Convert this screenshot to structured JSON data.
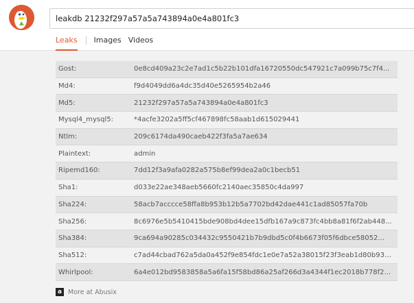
{
  "search": {
    "query": "leakdb 21232f297a57a5a743894a0e4a801fc3"
  },
  "tabs": [
    {
      "label": "Leaks"
    },
    {
      "label": "Images"
    },
    {
      "label": "Videos"
    }
  ],
  "results": [
    {
      "key": "Gost:",
      "value": "0e8cd409a23c2e7ad1c5b22b101dfa16720550dc547921c7a099b75c7f4..."
    },
    {
      "key": "Md4:",
      "value": "f9d4049dd6a4dc35d40e5265954b2a46"
    },
    {
      "key": "Md5:",
      "value": "21232f297a57a5a743894a0e4a801fc3"
    },
    {
      "key": "Mysql4_mysql5:",
      "value": "*4acfe3202a5ff5cf467898fc58aab1d615029441"
    },
    {
      "key": "Ntlm:",
      "value": "209c6174da490caeb422f3fa5a7ae634"
    },
    {
      "key": "Plaintext:",
      "value": "admin"
    },
    {
      "key": "Ripemd160:",
      "value": "7dd12f3a9afa0282a575b8ef99dea2a0c1becb51"
    },
    {
      "key": "Sha1:",
      "value": "d033e22ae348aeb5660fc2140aec35850c4da997"
    },
    {
      "key": "Sha224:",
      "value": "58acb7acccce58ffa8b953b12b5a7702bd42dae441c1ad85057fa70b"
    },
    {
      "key": "Sha256:",
      "value": "8c6976e5b5410415bde908bd4dee15dfb167a9c873fc4bb8a81f6f2ab448..."
    },
    {
      "key": "Sha384:",
      "value": "9ca694a90285c034432c9550421b7b9dbd5c0f4b6673f05f6dbce58052..."
    },
    {
      "key": "Sha512:",
      "value": "c7ad44cbad762a5da0a452f9e854fdc1e0e7a52a38015f23f3eab1d80b931..."
    },
    {
      "key": "Whirlpool:",
      "value": "6a4e012bd9583858a5a6fa15f58bd86a25af266d3a4344f1ec2018b778f2..."
    }
  ],
  "footer": {
    "label": "More at Abusix",
    "logo_letter": "a"
  },
  "colors": {
    "accent": "#de5833",
    "logo_bg": "#de5833"
  },
  "icons": {
    "logo": "duckduckgo-logo-icon",
    "footer": "abusix-logo-icon"
  }
}
